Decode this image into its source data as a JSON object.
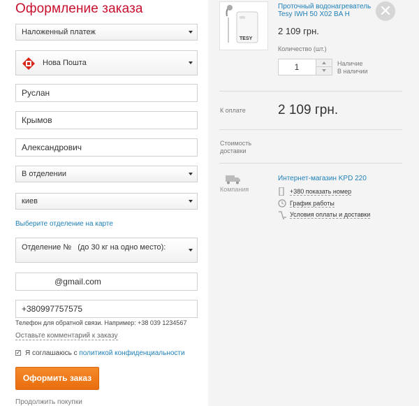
{
  "page": {
    "title": "Оформление заказа"
  },
  "form": {
    "payment_method": "Наложенный платеж",
    "carrier": "Нова Пошта",
    "first_name": "Руслан",
    "last_name": "Крымов",
    "middle_name": "Александрович",
    "delivery_type": "В отделении",
    "city": "киев",
    "choose_on_map": "Выберите отделение на карте",
    "branch_label": "Отделение №",
    "branch_note": "(до 30 кг на одно место):",
    "email": "@gmail.com",
    "phone": "+380997757575",
    "phone_hint": "Телефон для обратной связи. Например: +38 039 1234567",
    "leave_comment": "Оставьте комментарий к заказу",
    "agree_text": "Я соглашаюсь с",
    "privacy_link": "политикой конфиденциальности",
    "agree_checked": true,
    "submit_label": "Оформить заказ",
    "continue_label": "Продолжить покупки"
  },
  "cart": {
    "product_name": "Проточный водонагреватель Tesy IWH 50 X02 BA H",
    "product_brand": "TESY",
    "price": "2 109 грн.",
    "quantity_label": "Количество (шт.)",
    "quantity": "1",
    "availability_line1": "Наличие",
    "availability_line2": "В наличии",
    "total_label": "К оплате",
    "total_value": "2 109 грн.",
    "delivery_cost_line1": "Стоимость",
    "delivery_cost_line2": "доставки",
    "company_label": "Компания",
    "shop_name": "Интернет-магазин KPD 220",
    "show_phone": "+380 показать номер",
    "schedule": "График работы",
    "payment_terms": "Условия оплаты и доставки"
  },
  "colors": {
    "accent": "#c8102e",
    "link": "#1e7fb8",
    "button": "#f07d1c"
  }
}
